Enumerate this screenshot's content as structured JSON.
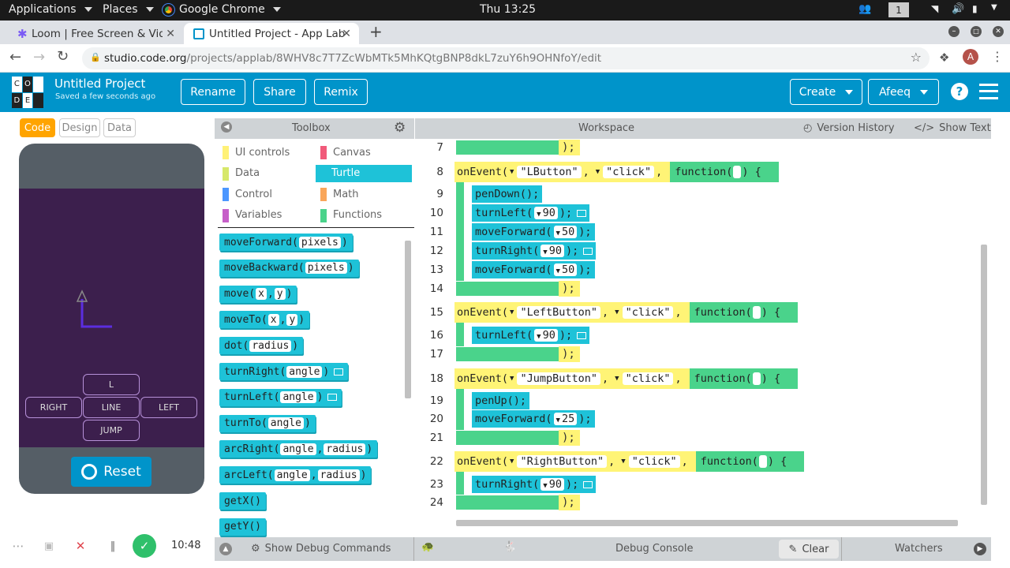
{
  "system": {
    "applications": "Applications",
    "places": "Places",
    "chrome": "Google Chrome",
    "clock": "Thu 13:25",
    "workspace_num": "1"
  },
  "tabs": [
    {
      "title": "Loom | Free Screen & Vide"
    },
    {
      "title": "Untitled Project - App Lab"
    }
  ],
  "url": {
    "host": "studio.code.org",
    "path": "/projects/applab/8WHV8c7T7ZcWbMTk5MhKQtgBNP8dkL7zuY6h9OHNfoY/edit"
  },
  "avatar_letter": "A",
  "logo": [
    "C",
    "O",
    "D",
    "E"
  ],
  "project": {
    "title": "Untitled Project",
    "saved": "Saved a few seconds ago"
  },
  "header_buttons": {
    "rename": "Rename",
    "share": "Share",
    "remix": "Remix",
    "create": "Create",
    "user": "Afeeq"
  },
  "modes": {
    "code": "Code",
    "design": "Design",
    "data": "Data"
  },
  "app_buttons": {
    "l": "L",
    "right": "RIGHT",
    "line": "LINE",
    "left": "LEFT",
    "jump": "JUMP"
  },
  "reset": "Reset",
  "toolbox": {
    "title": "Toolbox",
    "categories": [
      {
        "label": "UI controls",
        "color": "#fff176"
      },
      {
        "label": "Canvas",
        "color": "#f15a7a"
      },
      {
        "label": "Data",
        "color": "#d7e86a"
      },
      {
        "label": "Turtle",
        "color": "#1ec2d8"
      },
      {
        "label": "Control",
        "color": "#4c97ff"
      },
      {
        "label": "Math",
        "color": "#f9a65a"
      },
      {
        "label": "Variables",
        "color": "#c65fc8"
      },
      {
        "label": "Functions",
        "color": "#4ad38b"
      }
    ],
    "blocks": [
      {
        "name": "moveForward",
        "args": [
          "pixels"
        ]
      },
      {
        "name": "moveBackward",
        "args": [
          "pixels"
        ]
      },
      {
        "name": "move",
        "args": [
          "x",
          "y"
        ]
      },
      {
        "name": "moveTo",
        "args": [
          "x",
          "y"
        ]
      },
      {
        "name": "dot",
        "args": [
          "radius"
        ]
      },
      {
        "name": "turnRight",
        "args": [
          "angle"
        ]
      },
      {
        "name": "turnLeft",
        "args": [
          "angle"
        ]
      },
      {
        "name": "turnTo",
        "args": [
          "angle"
        ]
      },
      {
        "name": "arcRight",
        "args": [
          "angle",
          "radius"
        ]
      },
      {
        "name": "arcLeft",
        "args": [
          "angle",
          "radius"
        ]
      },
      {
        "name": "getX",
        "args": []
      },
      {
        "name": "getY",
        "args": []
      }
    ]
  },
  "workspace": {
    "title": "Workspace",
    "version_history": "Version History",
    "show_text": "Show Text",
    "line_numbers": [
      "7",
      "8",
      "9",
      "10",
      "11",
      "12",
      "13",
      "14",
      "15",
      "16",
      "17",
      "18",
      "19",
      "20",
      "21",
      "22",
      "23",
      "24"
    ],
    "events": [
      {
        "kw": "onEvent(",
        "id": "\"LButton\"",
        "evt": "\"click\"",
        "fn": "function(",
        "stmts": [
          "penDown();",
          "turnLeft(",
          "moveForward(",
          "turnRight(",
          "moveForward("
        ],
        "vals": [
          "",
          "90",
          "50",
          "90",
          "50"
        ]
      },
      {
        "kw": "onEvent(",
        "id": "\"LeftButton\"",
        "evt": "\"click\"",
        "fn": "function(",
        "stmts": [
          "turnLeft("
        ],
        "vals": [
          "90"
        ]
      },
      {
        "kw": "onEvent(",
        "id": "\"JumpButton\"",
        "evt": "\"click\"",
        "fn": "function(",
        "stmts": [
          "penUp();",
          "moveForward("
        ],
        "vals": [
          "",
          "25"
        ]
      },
      {
        "kw": "onEvent(",
        "id": "\"RightButton\"",
        "evt": "\"click\"",
        "fn": "function(",
        "stmts": [
          "turnRight("
        ],
        "vals": [
          "90"
        ]
      }
    ],
    "close": ");",
    "fn_close": ") {",
    "arg_sep": ",",
    "stmt_end": ");"
  },
  "bottom": {
    "debug_commands": "Show Debug Commands",
    "debug_console": "Debug Console",
    "clear": "Clear",
    "watchers": "Watchers"
  },
  "recorder": {
    "time": "10:48"
  }
}
